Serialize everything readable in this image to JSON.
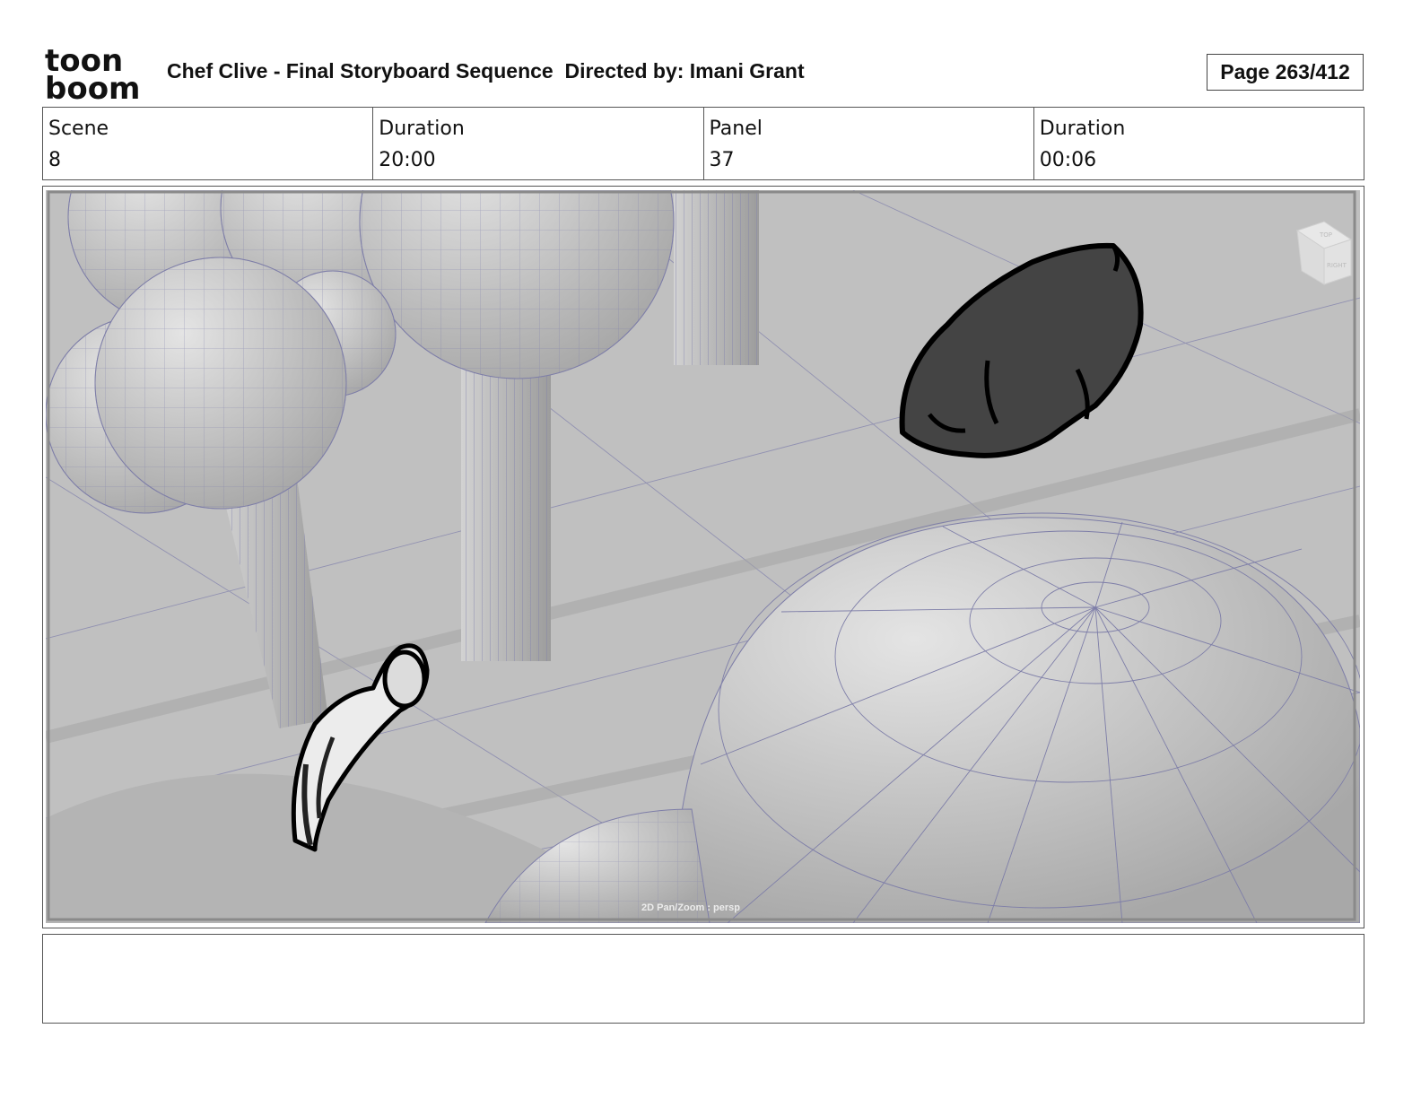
{
  "header": {
    "logo": {
      "line1": "toon",
      "line2": "boom"
    },
    "title": "Chef Clive - Final Storyboard Sequence  Directed by: Imani Grant",
    "page_label": "Page 263/412"
  },
  "info": [
    {
      "label": "Scene",
      "value": "8"
    },
    {
      "label": "Duration",
      "value": "20:00"
    },
    {
      "label": "Panel",
      "value": "37"
    },
    {
      "label": "Duration",
      "value": "00:06"
    }
  ],
  "panel": {
    "viewport_label": "2D Pan/Zoom : persp",
    "view_cube": {
      "face_top": "TOP",
      "face_side": "RIGHT"
    }
  },
  "notes": {
    "text": ""
  },
  "colors": {
    "viewport_bg": "#bdbdbd",
    "wire": "#7e7ea8",
    "bear": "#444444"
  }
}
